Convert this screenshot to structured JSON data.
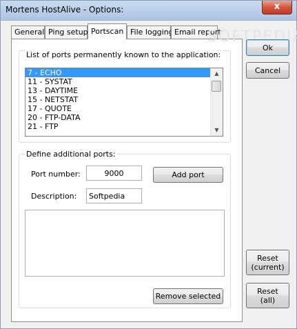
{
  "window": {
    "title": "Mortens HostAlive - Options:",
    "close_glyph": "x"
  },
  "tabs": [
    {
      "label": "General"
    },
    {
      "label": "Ping setup"
    },
    {
      "label": "Portscan"
    },
    {
      "label": "File logging"
    },
    {
      "label": "Email report"
    }
  ],
  "active_tab": "Portscan",
  "known_ports": {
    "label": "List of ports permanently known to the application:",
    "items": [
      "7 - ECHO",
      "11 - SYSTAT",
      "13 - DAYTIME",
      "15 - NETSTAT",
      "17 - QUOTE",
      "20 - FTP-DATA",
      "21 - FTP"
    ],
    "selected_index": 0
  },
  "additional_ports": {
    "label": "Define additional ports:",
    "port_number_label": "Port number:",
    "port_number_value": "9000",
    "add_port_label": "Add port",
    "description_label": "Description:",
    "description_value": "Softpedia",
    "remove_selected_label": "Remove selected"
  },
  "side_buttons": {
    "ok": "Ok",
    "cancel": "Cancel",
    "reset_current_line1": "Reset",
    "reset_current_line2": "(current)",
    "reset_all_line1": "Reset",
    "reset_all_line2": "(all)"
  },
  "watermark": "SOFTPEDIA"
}
